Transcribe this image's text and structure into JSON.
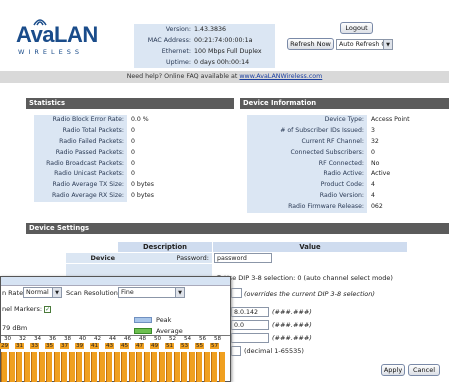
{
  "header": {
    "logo_main": "AvaLAN",
    "logo_sub": "WIRELESS",
    "info": [
      {
        "label": "Version:",
        "value": "1.43.3836"
      },
      {
        "label": "MAC Address:",
        "value": "00:21:74:00:00:1a"
      },
      {
        "label": "Ethernet:",
        "value": "100 Mbps Full Duplex"
      },
      {
        "label": "Uptime:",
        "value": "0 days 00h:00:14"
      }
    ],
    "logout_label": "Logout",
    "refresh_now_label": "Refresh Now",
    "auto_refresh_value": "Auto Refresh Off"
  },
  "help": {
    "text": "Need help?  Online FAQ available at",
    "link": "www.AvaLANWireless.com"
  },
  "statistics": {
    "title": "Statistics",
    "rows": [
      {
        "label": "Radio Block Error Rate:",
        "value": "0.0 %"
      },
      {
        "label": "Radio Total Packets:",
        "value": "0"
      },
      {
        "label": "Radio Failed Packets:",
        "value": "0"
      },
      {
        "label": "Radio Passed Packets:",
        "value": "0"
      },
      {
        "label": "Radio Broadcast Packets:",
        "value": "0"
      },
      {
        "label": "Radio Unicast Packets:",
        "value": "0"
      },
      {
        "label": "Radio Average TX Size:",
        "value": "0 bytes"
      },
      {
        "label": "Radio Average RX Size:",
        "value": "0 bytes"
      }
    ]
  },
  "device_info": {
    "title": "Device Information",
    "rows": [
      {
        "label": "Device Type:",
        "value": "Access Point"
      },
      {
        "label": "# of Subscriber IDs Issued:",
        "value": "3"
      },
      {
        "label": "Current RF Channel:",
        "value": "32"
      },
      {
        "label": "Connected Subscribers:",
        "value": "0"
      },
      {
        "label": "RF Connected:",
        "value": "No"
      },
      {
        "label": "Radio Active:",
        "value": "Active"
      },
      {
        "label": "Product Code:",
        "value": "4"
      },
      {
        "label": "Radio Version:",
        "value": "4"
      },
      {
        "label": "Radio Firmware Release:",
        "value": "062"
      }
    ]
  },
  "device_settings": {
    "title": "Device Settings",
    "col_description": "Description",
    "col_value": "Value",
    "device_label": "Device",
    "password_label": "Password:",
    "password_value": "password",
    "dip_text": "Use DIP 3-8 selection: 0 (auto channel select mode)",
    "override_text": "(overrides the current DIP 3-8 selection)",
    "ip_value": "8.0.142",
    "ip_hint": "(###.###)",
    "mask_value": "0.0",
    "mask_hint": "(###.###)",
    "gw_hint": "(###.###)",
    "id_hint": "(decimal 1-65535)",
    "apply_label": "Apply",
    "cancel_label": "Cancel"
  },
  "scan_window": {
    "scan_rate_label": "n Rate:",
    "scan_rate_value": "Normal",
    "scan_res_label": "Scan Resolution:",
    "scan_res_value": "Fine",
    "markers_label": "nel Markers:",
    "level_text": "79 dBm",
    "legend_peak": "Peak",
    "legend_avg": "Average",
    "top_ticks": [
      "30",
      "32",
      "34",
      "36",
      "38",
      "40",
      "42",
      "44",
      "46",
      "48",
      "50",
      "52",
      "54",
      "56",
      "58"
    ],
    "bottom_ticks": [
      "29",
      "31",
      "33",
      "35",
      "37",
      "39",
      "41",
      "43",
      "45",
      "47",
      "49",
      "51",
      "53",
      "55",
      "57"
    ],
    "colors": {
      "peak": "#a9c6ea",
      "average": "#6cbf4f",
      "channel": "#f0a020"
    }
  }
}
